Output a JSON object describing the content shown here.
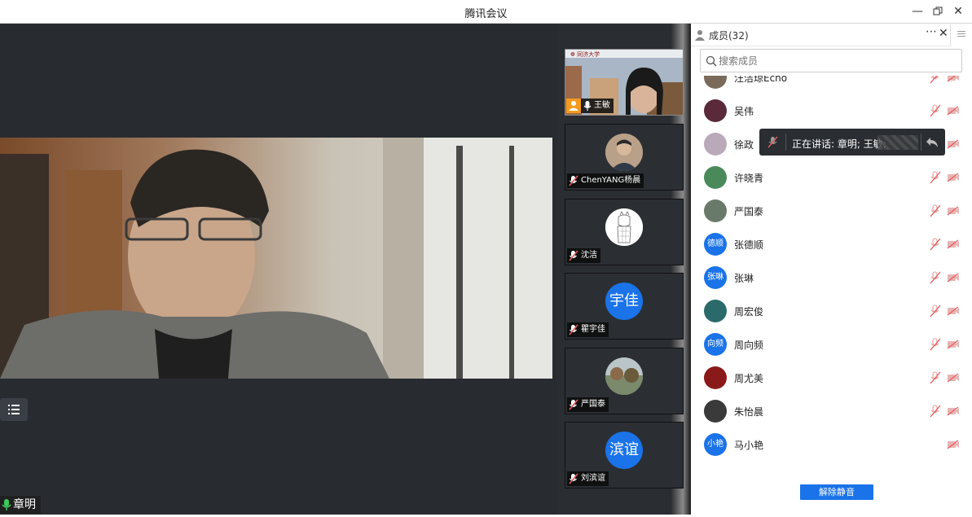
{
  "window": {
    "title": "腾讯会议"
  },
  "main": {
    "speaker_name": "章明"
  },
  "thumbs": [
    {
      "name": "王敏"
    },
    {
      "name": "ChenYANG杨晨"
    },
    {
      "name": "沈洁"
    },
    {
      "name": "瞿宇佳",
      "avatar_text": "宇佳",
      "avatar_color": "#1a73e8"
    },
    {
      "name": "严国泰"
    },
    {
      "name": "刘滨谊",
      "avatar_text": "滨谊",
      "avatar_color": "#1a73e8"
    }
  ],
  "sidebar": {
    "title": "成员(32)",
    "search_placeholder": "搜索成员",
    "members": [
      {
        "name": "汪洁琼Echo",
        "avatar_color": "#7a6a5a"
      },
      {
        "name": "吴伟",
        "avatar_color": "#5a2a3a"
      },
      {
        "name": "徐政",
        "avatar_color": "#b9a9b9"
      },
      {
        "name": "许晓青",
        "avatar_color": "#4a8a5a"
      },
      {
        "name": "严国泰",
        "avatar_color": "#6a7a6a"
      },
      {
        "name": "张德顺",
        "avatar_text": "德顺",
        "avatar_color": "#1a73e8"
      },
      {
        "name": "张琳",
        "avatar_text": "张琳",
        "avatar_color": "#1a73e8"
      },
      {
        "name": "周宏俊",
        "avatar_color": "#2a6a6a"
      },
      {
        "name": "周向频",
        "avatar_text": "向频",
        "avatar_color": "#1a73e8"
      },
      {
        "name": "周尤美",
        "avatar_color": "#8a1a1a"
      },
      {
        "name": "朱怡晨",
        "avatar_color": "#3a3a3a"
      },
      {
        "name": "马小艳",
        "avatar_text": "小艳",
        "avatar_color": "#1a73e8"
      }
    ],
    "unmute_label": "解除静音"
  },
  "tooltip": {
    "text": "正在讲话: 章明; 王敏;"
  },
  "colors": {
    "accent": "#1a73e8",
    "mute_red": "#e25b5b"
  }
}
